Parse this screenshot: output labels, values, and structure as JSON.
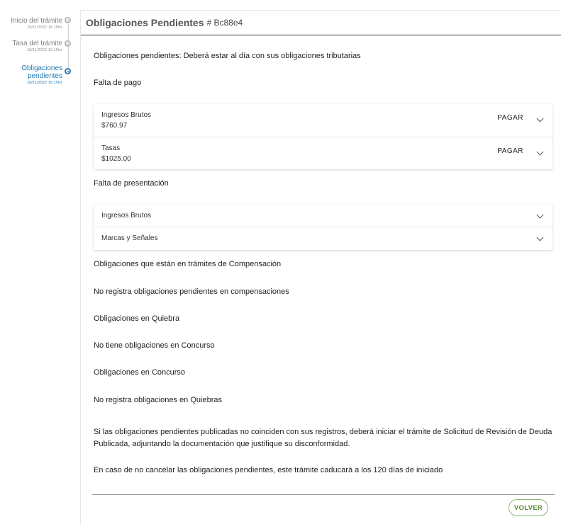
{
  "stepper": {
    "steps": [
      {
        "label": "Inicio del trámite",
        "date": "18/11/2022 16:15hs"
      },
      {
        "label": "Tasa del trámite",
        "date": "18/11/2022 16:15hs"
      },
      {
        "label_line1": "Obligaciones",
        "label_line2": "pendientes",
        "date": "18/11/2022 16:15hs"
      }
    ]
  },
  "header": {
    "title": "Obligaciones Pendientes",
    "code": "# Bc88e4"
  },
  "intro": "Obligaciones pendientes: Deberá estar al día con sus obligaciones tributarias",
  "falta_pago": {
    "title": "Falta de pago",
    "items": [
      {
        "name": "Ingresos Brutos",
        "amount": "$760.97",
        "action": "PAGAR"
      },
      {
        "name": "Tasas",
        "amount": "$1025.00",
        "action": "PAGAR"
      }
    ]
  },
  "falta_presentacion": {
    "title": "Falta de presentación",
    "items": [
      {
        "name": "Ingresos Brutos"
      },
      {
        "name": "Marcas y Señales"
      }
    ]
  },
  "compensacion": {
    "title": "Obligaciones que están en trámites de Compensación",
    "text": "No registra obligaciones pendientes en compensaciones"
  },
  "quiebra": {
    "title": "Obligaciones en Quiebra",
    "text": "No tiene obligaciones en Concurso"
  },
  "concurso": {
    "title": "Obligaciones en Concurso",
    "text": "No registra obligaciones en Quiebras"
  },
  "note_line1": "Si las obligaciones pendientes publicadas no coinciden con sus registros, deberá iniciar el trámite de Solicitud de Revisión de Deuda",
  "note_line2": "Publicada, adjuntando la documentación que justifique su disconformidad.",
  "expiry": "En caso de no cancelar las obligaciones pendientes, este trámite caducará a los 120 días de iniciado",
  "buttons": {
    "back": "VOLVER"
  },
  "colors": {
    "accent": "#2b7bb9",
    "button_border": "#8ab56a",
    "button_text": "#5a8c3a"
  }
}
